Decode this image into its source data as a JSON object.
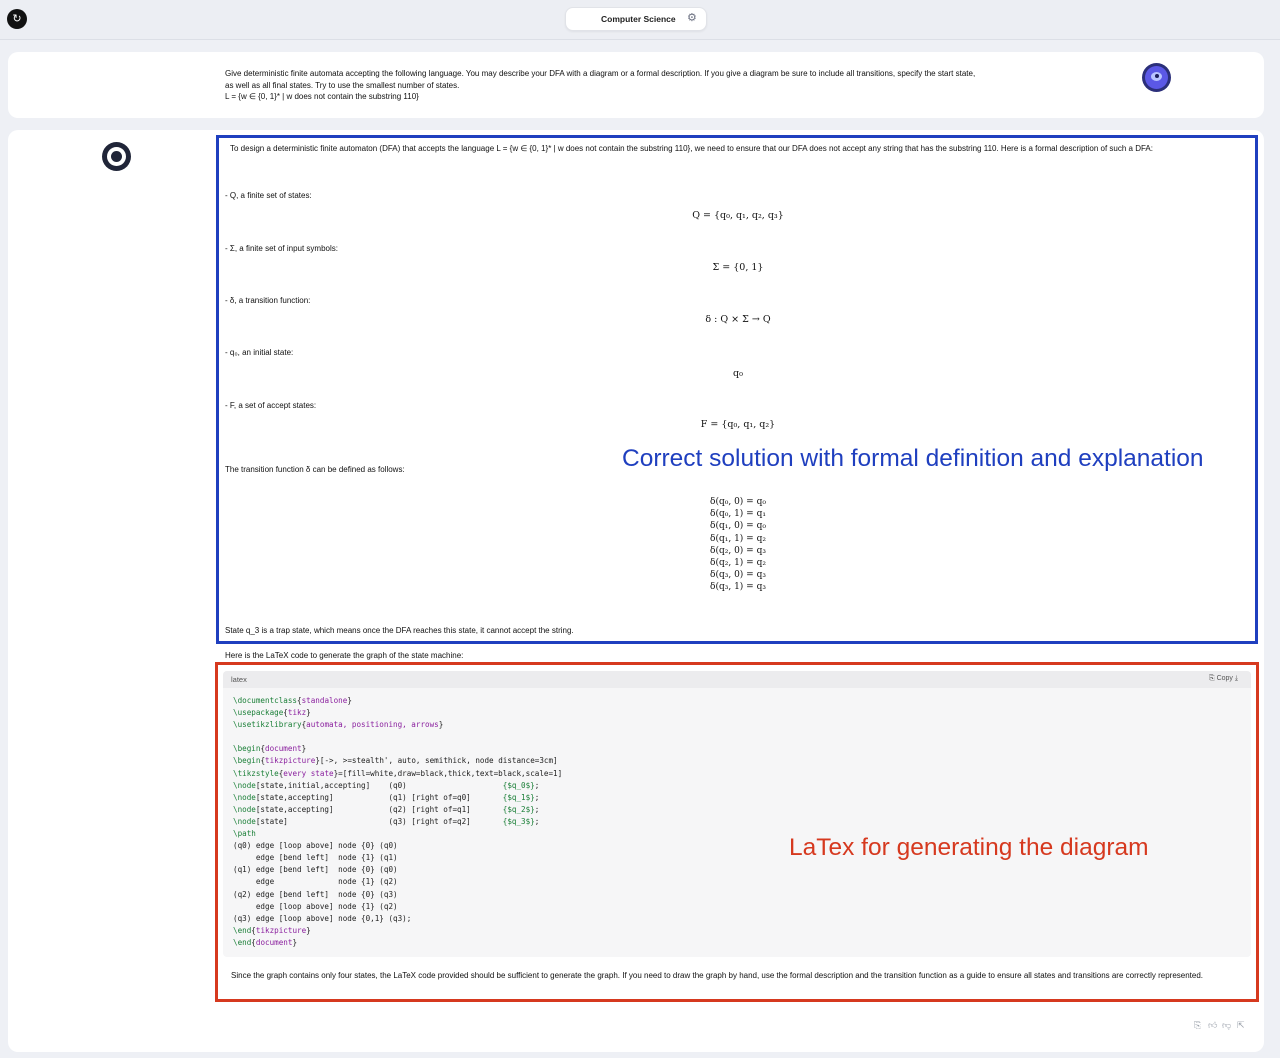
{
  "header": {
    "title": "Computer Science",
    "back_icon": "↻",
    "settings_icon": "⚙"
  },
  "question": {
    "lines": [
      "Give deterministic finite automata accepting the following language. You may describe your DFA with a diagram or a formal description. If you give a diagram be sure to include all transitions, specify the start state,",
      "as well as all final states. Try to use the smallest number of states.",
      "L = {w ∈ {0, 1}* | w does not contain the substring 110}"
    ]
  },
  "answer": {
    "intro": "To design a deterministic finite automaton (DFA) that accepts the language L = {w ∈ {0, 1}* | w does not contain the substring 110}, we need to ensure that our DFA does not accept any string that has the substring 110. Here is a formal description of such a DFA:",
    "items": [
      {
        "label": "- Q, a finite set of states:",
        "math": "Q = {q₀, q₁, q₂, q₃}"
      },
      {
        "label": "- Σ, a finite set of input symbols:",
        "math": "Σ = {0, 1}"
      },
      {
        "label": "- δ, a transition function:",
        "math": "δ : Q × Σ → Q"
      },
      {
        "label": "- q₀, an initial state:",
        "math": "q₀"
      },
      {
        "label": "- F, a set of accept states:",
        "math": "F = {q₀, q₁, q₂}"
      }
    ],
    "transition_intro": "The transition function δ can be defined as follows:",
    "transitions": [
      "δ(q₀, 0) = q₀",
      "δ(q₀, 1) = q₁",
      "δ(q₁, 0) = q₀",
      "δ(q₁, 1) = q₂",
      "δ(q₂, 0) = q₃",
      "δ(q₂, 1) = q₂",
      "δ(q₃, 0) = q₃",
      "δ(q₃, 1) = q₃"
    ],
    "trap_note": "State q_3 is a trap state, which means once the DFA reaches this state, it cannot accept the string.",
    "latex_intro": "Here is the LaTeX code to generate the graph of the state machine:",
    "code_lang": "latex",
    "copy_label": "Copy",
    "outro_lines": [
      "Since the graph contains only four states, the LaTeX code provided should be sufficient to generate the graph. If you need to draw the graph by hand, use the formal description and the transition function as a guide to ensure all states and transitions are correctly",
      "represented."
    ]
  },
  "annotations": {
    "blue": "Correct solution with formal definition and explanation",
    "red": "LaTex for generating the diagram",
    "blue_color": "#1f3fbf",
    "red_color": "#d6391f"
  },
  "code_lines": [
    "\\documentclass{standalone}",
    "\\usepackage{tikz}",
    "\\usetikzlibrary{automata, positioning, arrows}",
    "",
    "\\begin{document}",
    "\\begin{tikzpicture}[->, >=stealth', auto, semithick, node distance=3cm]",
    "\\tikzstyle{every state}=[fill=white,draw=black,thick,text=black,scale=1]",
    "\\node[state,initial,accepting]    (q0)                     {$q_0$};",
    "\\node[state,accepting]            (q1) [right of=q0]       {$q_1$};",
    "\\node[state,accepting]            (q2) [right of=q1]       {$q_2$};",
    "\\node[state]                      (q3) [right of=q2]       {$q_3$};",
    "\\path",
    "(q0) edge [loop above] node {0} (q0)",
    "     edge [bend left]  node {1} (q1)",
    "(q1) edge [bend left]  node {0} (q0)",
    "     edge              node {1} (q2)",
    "(q2) edge [bend left]  node {0} (q3)",
    "     edge [loop above] node {1} (q2)",
    "(q3) edge [loop above] node {0,1} (q3);",
    "\\end{tikzpicture}",
    "\\end{document}"
  ],
  "footer_actions": [
    "clipboard-icon",
    "thumbs-up-icon",
    "thumbs-down-icon",
    "share-icon"
  ]
}
